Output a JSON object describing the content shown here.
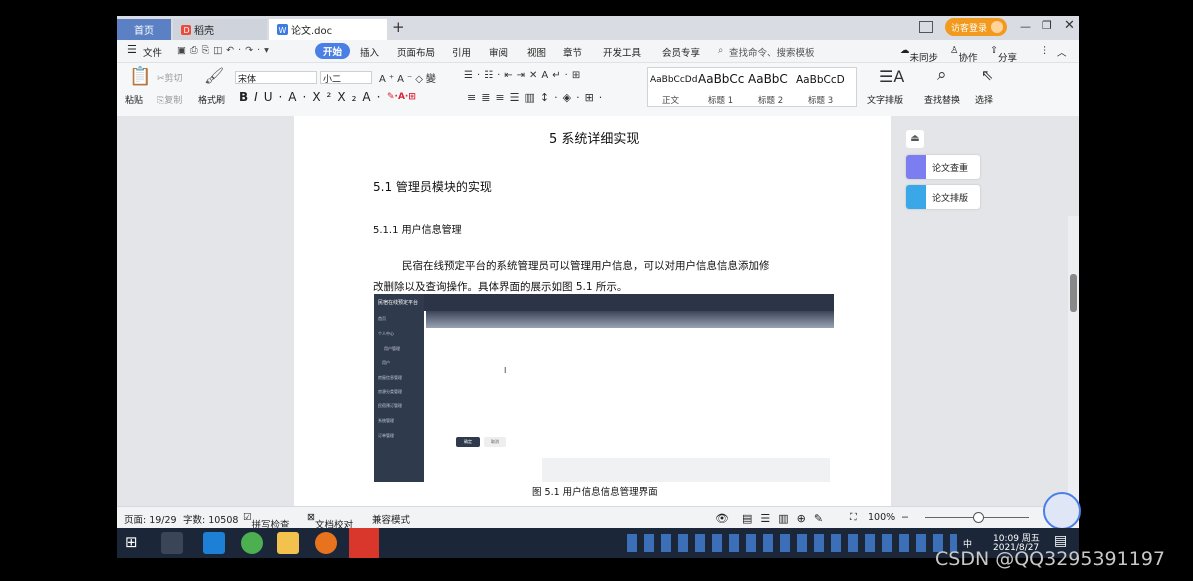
{
  "tabs": [
    {
      "label": "首页"
    },
    {
      "label": "稻壳"
    },
    {
      "label": "论文.doc"
    }
  ],
  "titlebar": {
    "new_tab": "+",
    "login": "访客登录"
  },
  "menu": {
    "file": "文件",
    "items": [
      "开始",
      "插入",
      "页面布局",
      "引用",
      "审阅",
      "视图",
      "章节",
      "开发工具",
      "会员专享"
    ],
    "search": "查找命令、搜索模板",
    "unsync": "未同步",
    "collab": "协作",
    "share": "分享"
  },
  "ribbon": {
    "paste": "粘贴",
    "cut": "剪切",
    "copy": "复制",
    "format_painter": "格式刷",
    "font_name": "宋体",
    "font_size": "小二",
    "styles": [
      {
        "sample": "AaBbCcDd",
        "name": "正文"
      },
      {
        "sample": "AaBbCc",
        "name": "标题 1"
      },
      {
        "sample": "AaBbC",
        "name": "标题 2"
      },
      {
        "sample": "AaBbCcD",
        "name": "标题 3"
      }
    ],
    "text_layout": "文字排版",
    "find_replace": "查找替换",
    "select": "选择"
  },
  "document": {
    "chapter_title": "5 系统详细实现",
    "section_title": "5.1  管理员模块的实现",
    "subsection_title": "5.1.1  用户信息管理",
    "para_line1": "民宿在线预定平台的系统管理员可以管理用户信息，可以对用户信息信息添加修",
    "para_line2": "改删除以及查询操作。具体界面的展示如图 5.1 所示。",
    "figure_caption": "图 5.1  用户信息信息管理界面",
    "screenshot": {
      "app_title": "民宿在线预定平台",
      "menu": [
        "首页",
        "个人中心",
        "用户管理",
        "用户",
        "房屋信息管理",
        "房源分类管理",
        "民宿预订管理",
        "系统管理",
        "订单管理"
      ],
      "btn_ok": "确定",
      "btn_cancel": "取消"
    }
  },
  "side_panel": {
    "check": "论文查重",
    "layout": "论文排版"
  },
  "status": {
    "page": "页面: 19/29",
    "words": "字数: 10508",
    "spell": "拼写检查",
    "proof": "文档校对",
    "compat": "兼容模式",
    "zoom": "100%"
  },
  "taskbar": {
    "time": "10:09 周五",
    "date": "2021/8/27",
    "input": "中"
  },
  "watermark": "CSDN @QQ3295391197",
  "colors": {
    "accent": "#4a7fe6",
    "brand_orange": "#f29a1d",
    "taskbar": "#1b2738"
  }
}
